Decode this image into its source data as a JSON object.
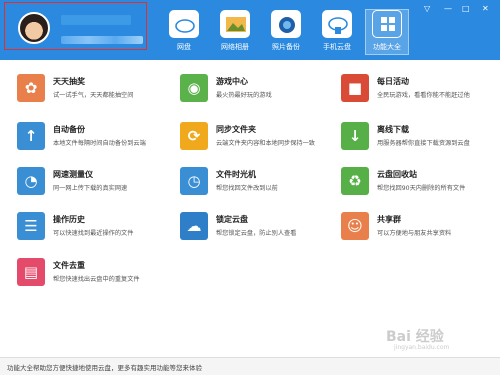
{
  "header": {
    "nav": [
      {
        "label": "网盘",
        "icon": "cloud-icon"
      },
      {
        "label": "网络相册",
        "icon": "photo-album-icon"
      },
      {
        "label": "照片备份",
        "icon": "camera-icon"
      },
      {
        "label": "手机云盘",
        "icon": "phone-cloud-icon"
      },
      {
        "label": "功能大全",
        "icon": "features-icon"
      }
    ],
    "window_controls": [
      "▽",
      "—",
      "□",
      "✕"
    ]
  },
  "features": [
    {
      "title": "天天抽奖",
      "desc": "试一试手气，天天都能抽空间",
      "icon": "lottery-icon",
      "color": "#e9804c"
    },
    {
      "title": "游戏中心",
      "desc": "最火热最好玩的游戏",
      "icon": "gamepad-icon",
      "color": "#5bb24a"
    },
    {
      "title": "每日活动",
      "desc": "全民玩游戏，看看你能不能赶过他",
      "icon": "gift-icon",
      "color": "#d94b36"
    },
    {
      "title": "自动备份",
      "desc": "本地文件每隔时间自动备份到云端",
      "icon": "upload-cloud-icon",
      "color": "#3a8fd4"
    },
    {
      "title": "同步文件夹",
      "desc": "云端文件夹内容和本地同步保持一致",
      "icon": "sync-icon",
      "color": "#f0a81c"
    },
    {
      "title": "离线下载",
      "desc": "用服务器帮你直接下载资源到云盘",
      "icon": "download-icon",
      "color": "#56b047"
    },
    {
      "title": "网速测量仪",
      "desc": "同一网上传下载的真实网速",
      "icon": "speedometer-icon",
      "color": "#3a8fd4"
    },
    {
      "title": "文件时光机",
      "desc": "帮您找回文件改到以前",
      "icon": "time-machine-icon",
      "color": "#3a8fd4"
    },
    {
      "title": "云盘回收站",
      "desc": "帮您找回90天内删除的所有文件",
      "icon": "recycle-icon",
      "color": "#56b047"
    },
    {
      "title": "操作历史",
      "desc": "可以快速找到最近操作的文件",
      "icon": "history-icon",
      "color": "#3a8fd4"
    },
    {
      "title": "锁定云盘",
      "desc": "帮您锁定云盘，防止别人查看",
      "icon": "lock-cloud-icon",
      "color": "#2f7fc8"
    },
    {
      "title": "共享群",
      "desc": "可以方便地与朋友共享资料",
      "icon": "share-group-icon",
      "color": "#e9804c"
    },
    {
      "title": "文件去重",
      "desc": "帮您快速找出云盘中的重复文件",
      "icon": "dedup-icon",
      "color": "#e44a6a"
    }
  ],
  "status_text": "功能大全帮助您方便快捷地使用云盘，更多有趣实用功能等您来体验",
  "watermark": "Bai 经验",
  "watermark_sub": "jingyan.baidu.com"
}
